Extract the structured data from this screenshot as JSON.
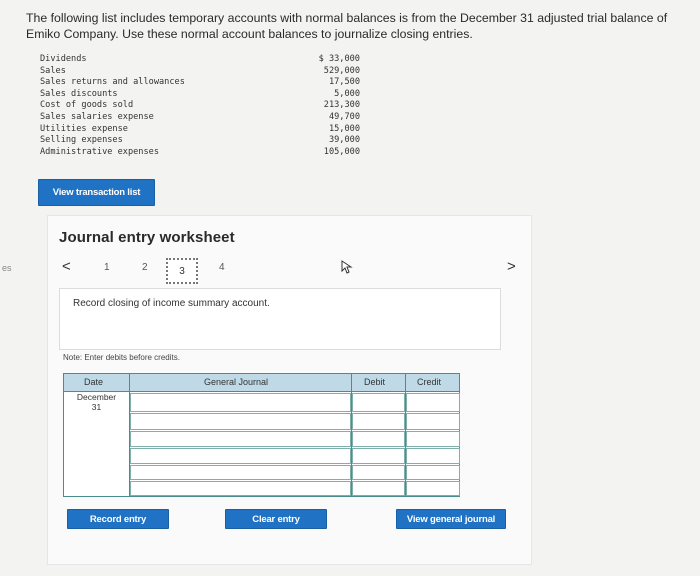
{
  "intro": "The following list includes temporary accounts with normal balances is from the December 31 adjusted trial balance of Emiko Company. Use these normal account balances to journalize closing entries.",
  "accounts": [
    {
      "name": "Dividends",
      "amount": "$ 33,000"
    },
    {
      "name": "Sales",
      "amount": "529,000"
    },
    {
      "name": "Sales returns and allowances",
      "amount": "17,500"
    },
    {
      "name": "Sales discounts",
      "amount": "5,000"
    },
    {
      "name": "Cost of goods sold",
      "amount": "213,300"
    },
    {
      "name": "Sales salaries expense",
      "amount": "49,700"
    },
    {
      "name": "Utilities expense",
      "amount": "15,000"
    },
    {
      "name": "Selling expenses",
      "amount": "39,000"
    },
    {
      "name": "Administrative expenses",
      "amount": "105,000"
    }
  ],
  "view_transaction_label": "View transaction list",
  "worksheet": {
    "title": "Journal entry worksheet",
    "pages": [
      "1",
      "2",
      "3",
      "4"
    ],
    "active_page": "3",
    "prev_icon": "<",
    "next_icon": ">",
    "instruction": "Record closing of income summary account.",
    "note": "Note: Enter debits before credits.",
    "table": {
      "headers": {
        "date": "Date",
        "journal": "General Journal",
        "debit": "Debit",
        "credit": "Credit"
      },
      "date_line1": "December",
      "date_line2": "31"
    },
    "record_label": "Record entry",
    "clear_label": "Clear entry",
    "view_general_label": "View general journal"
  },
  "side_glyph": "es"
}
